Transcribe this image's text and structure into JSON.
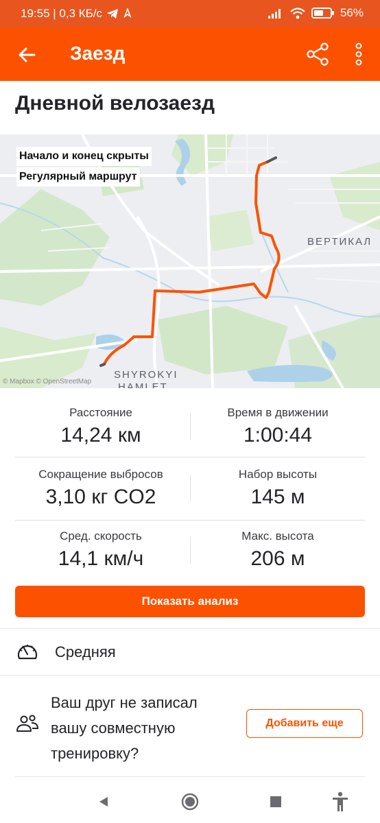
{
  "status_bar": {
    "time_net": "19:55 | 0,3 КБ/с",
    "battery": "56"
  },
  "app_bar": {
    "title": "Заезд",
    "icons": [
      "back-arrow-icon",
      "share-icon",
      "more-vert-icon"
    ]
  },
  "activity": {
    "title": "Дневной велозаезд"
  },
  "map": {
    "labels": [
      "Начало и конец скрыты",
      "Регулярный маршрут"
    ],
    "attribution": "© Mapbox © OpenStreetMap",
    "places": [
      "ВЕРТИКАЛ",
      "SHYROKYI",
      "HAMLET"
    ],
    "route_color": "#fc5200"
  },
  "stats": [
    {
      "label": "Расстояние",
      "value": "14,24 км"
    },
    {
      "label": "Время в движении",
      "value": "1:00:44"
    },
    {
      "label": "Сокращение выбросов",
      "value": "3,10 кг CO2"
    },
    {
      "label": "Набор высоты",
      "value": "145 м"
    },
    {
      "label": "Сред. скорость",
      "value": "14,1 км/ч"
    },
    {
      "label": "Макс. высота",
      "value": "206 м"
    }
  ],
  "analysis_button": "Показать анализ",
  "effort": {
    "label": "Средняя",
    "icon": "gauge-icon"
  },
  "friend_prompt": {
    "text": "Ваш друг не записал вашу совместную тренировку?",
    "button": "Добавить еще",
    "icon": "group-icon"
  },
  "nav": [
    "back-triangle-icon",
    "home-circle-icon",
    "recents-square-icon",
    "accessibility-icon"
  ],
  "colors": {
    "accent": "#fc5200",
    "status_bar": "#e8551f"
  }
}
